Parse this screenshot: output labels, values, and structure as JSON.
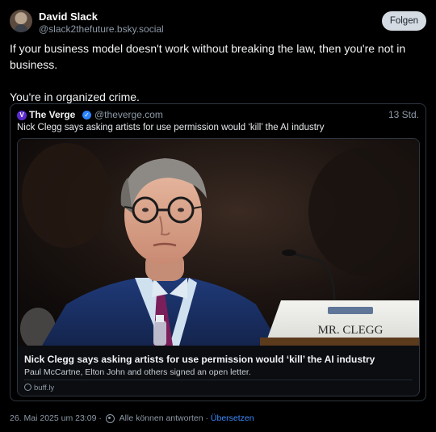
{
  "author": {
    "name": "David Slack",
    "handle": "@slack2thefuture.bsky.social",
    "avatar_icon": "user-avatar"
  },
  "follow_label": "Folgen",
  "post": {
    "text": "If your business model doesn't work without breaking the law, then you're not in business.\n\nYou're in organized crime."
  },
  "quote": {
    "logo_glyph": "V",
    "name": "The Verge",
    "verified_glyph": "✓",
    "handle": "@theverge.com",
    "time": "13 Std.",
    "text": "Nick Clegg says asking artists for use permission would ‘kill’ the AI industry",
    "card": {
      "title": "Nick Clegg says asking artists for use permission would ‘kill’ the AI industry",
      "description": "Paul McCartne, Elton John and others signed an open letter.",
      "domain": "buff.ly",
      "nameplate": "MR. CLEGG"
    }
  },
  "footer": {
    "date": "26. Mai 2025 um 23:09",
    "sep1": "·",
    "reply_setting": "Alle können antworten",
    "sep2": "·",
    "translate": "Übersetzen"
  },
  "colors": {
    "background": "#000000",
    "link": "#3d8bff",
    "verified": "#2b84ff",
    "verge_logo": "#5b2bd1"
  }
}
